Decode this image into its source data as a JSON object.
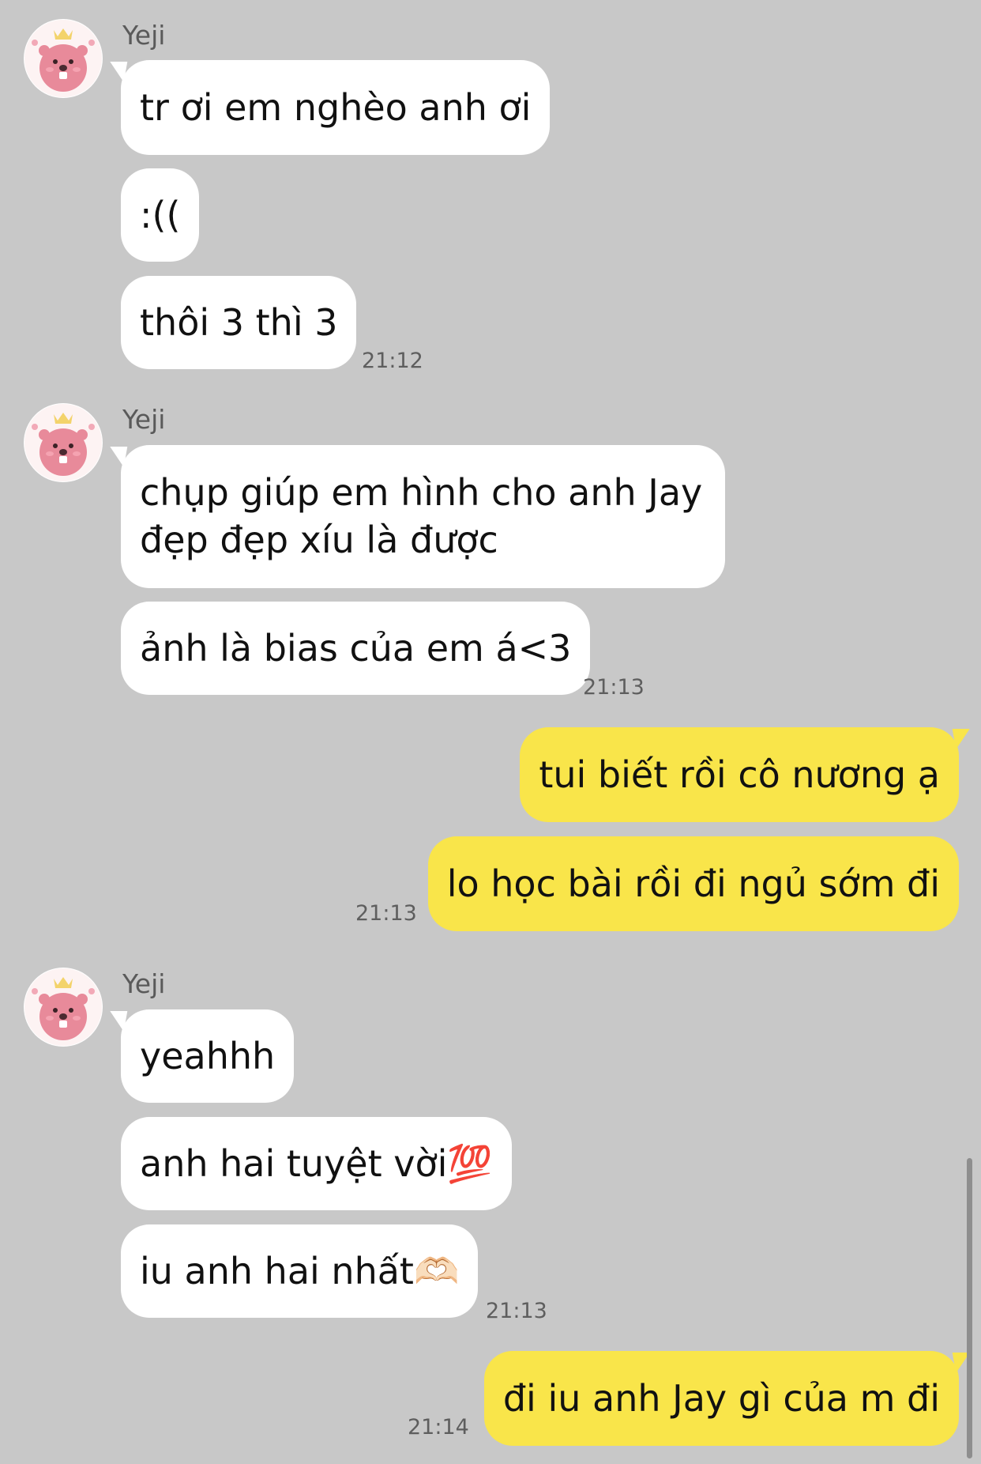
{
  "groups": [
    {
      "sender": "Yeji",
      "avatar_icon": "beaver-avatar-icon",
      "messages": [
        "tr ơi em nghèo anh ơi",
        ":((",
        "thôi 3 thì 3"
      ],
      "time": "21:12"
    },
    {
      "sender": "Yeji",
      "avatar_icon": "beaver-avatar-icon",
      "messages": [
        "chụp giúp em hình cho anh Jay",
        "đẹp đẹp xíu là được",
        "ảnh là bias của em á<3"
      ],
      "time": "21:13"
    },
    {
      "sender": "me",
      "messages": [
        "tui biết rồi cô nương ạ",
        "lo học bài rồi đi ngủ sớm đi"
      ],
      "time": "21:13"
    },
    {
      "sender": "Yeji",
      "avatar_icon": "beaver-avatar-icon",
      "messages": [
        "yeahhh",
        "anh hai tuyệt vời💯",
        "iu anh hai nhất🫶🏻"
      ],
      "time": "21:13"
    },
    {
      "sender": "me",
      "messages": [
        "đi iu anh Jay gì của m đi"
      ],
      "time": "21:14"
    }
  ],
  "colors": {
    "background": "#c8c8c8",
    "incoming_bubble": "#ffffff",
    "outgoing_bubble": "#f9e54a"
  }
}
